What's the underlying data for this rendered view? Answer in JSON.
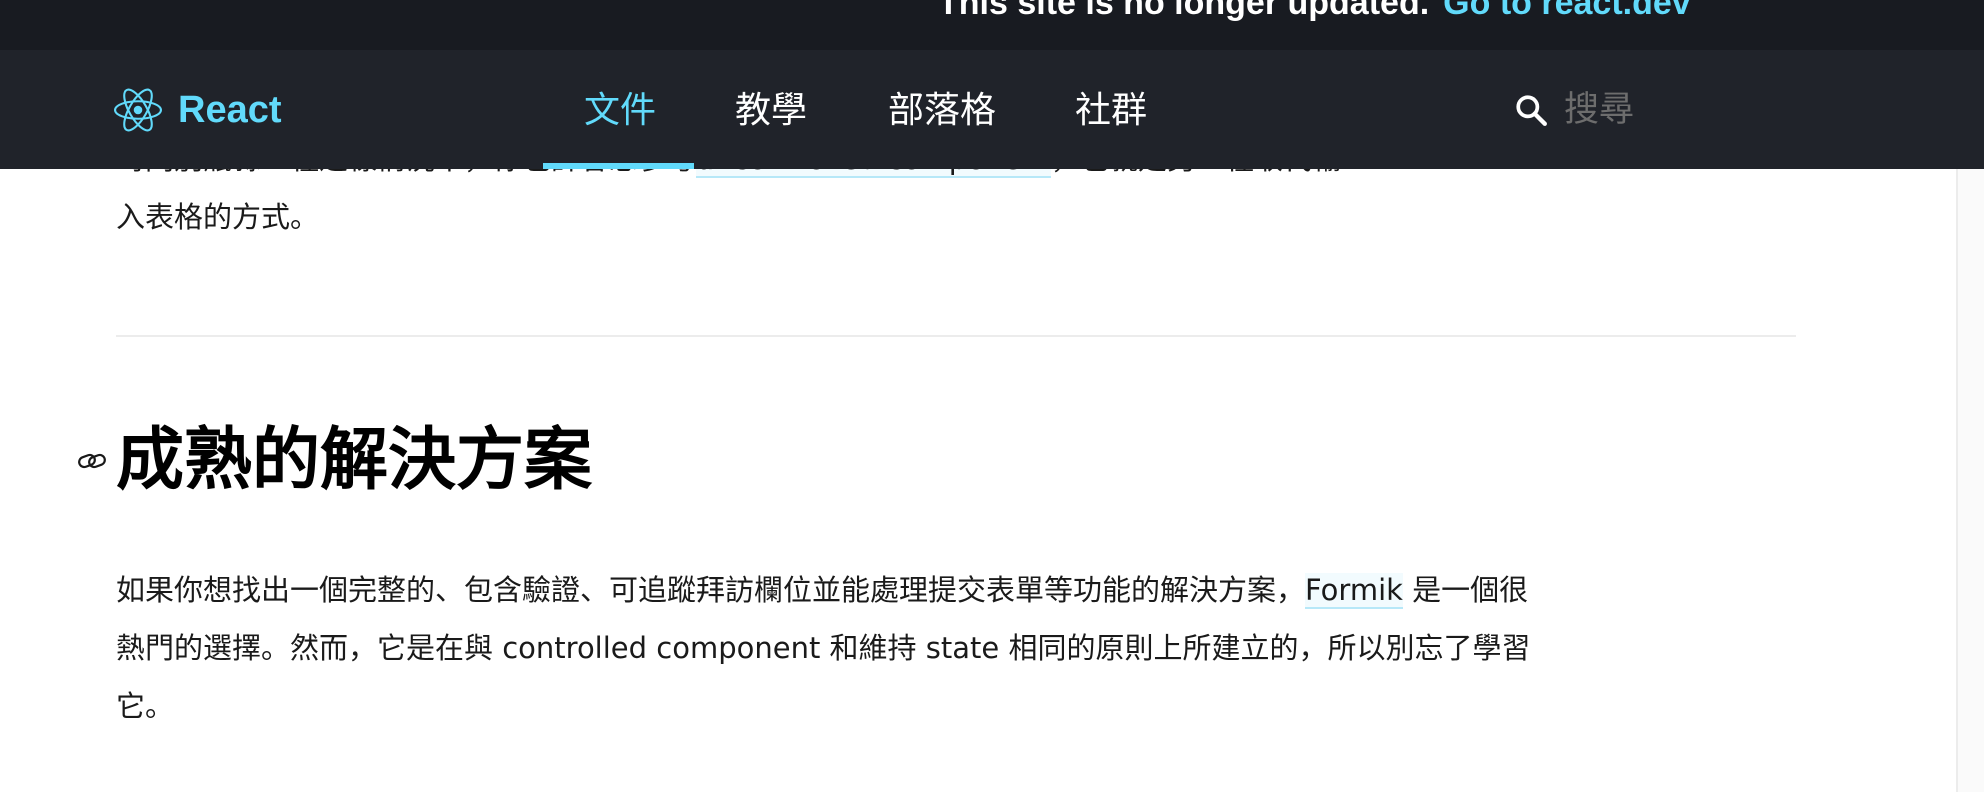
{
  "banner": {
    "text": "This site is no longer updated.",
    "link_label": "Go to react.dev"
  },
  "nav": {
    "logo_text": "React",
    "items": [
      {
        "label": "文件",
        "active": true
      },
      {
        "label": "教學",
        "active": false
      },
      {
        "label": "部落格",
        "active": false
      },
      {
        "label": "社群",
        "active": false
      }
    ],
    "search_placeholder": "搜尋"
  },
  "content": {
    "prev_paragraph": {
      "line1_before": "時同別瓶縣一種這樣情況中，你也許會想參考",
      "link": "uncontrolled component",
      "line1_after": "，也就是另一種取代輸",
      "line2": "入表格的方式。"
    },
    "heading": "成熟的解決方案",
    "paragraph": {
      "before_link": "如果你想找出一個完整的、包含驗證、可追蹤拜訪欄位並能處理提交表單等功能的解決方案，",
      "link": "Formik",
      "after_link": " 是一個很熱門的選擇。然而，它是在與 controlled component 和維持 state 相同的原則上所建立的，所以別忘了學習它。"
    }
  },
  "colors": {
    "banner_bg": "#181b21",
    "nav_bg": "#20232a",
    "accent": "#61dafb"
  }
}
